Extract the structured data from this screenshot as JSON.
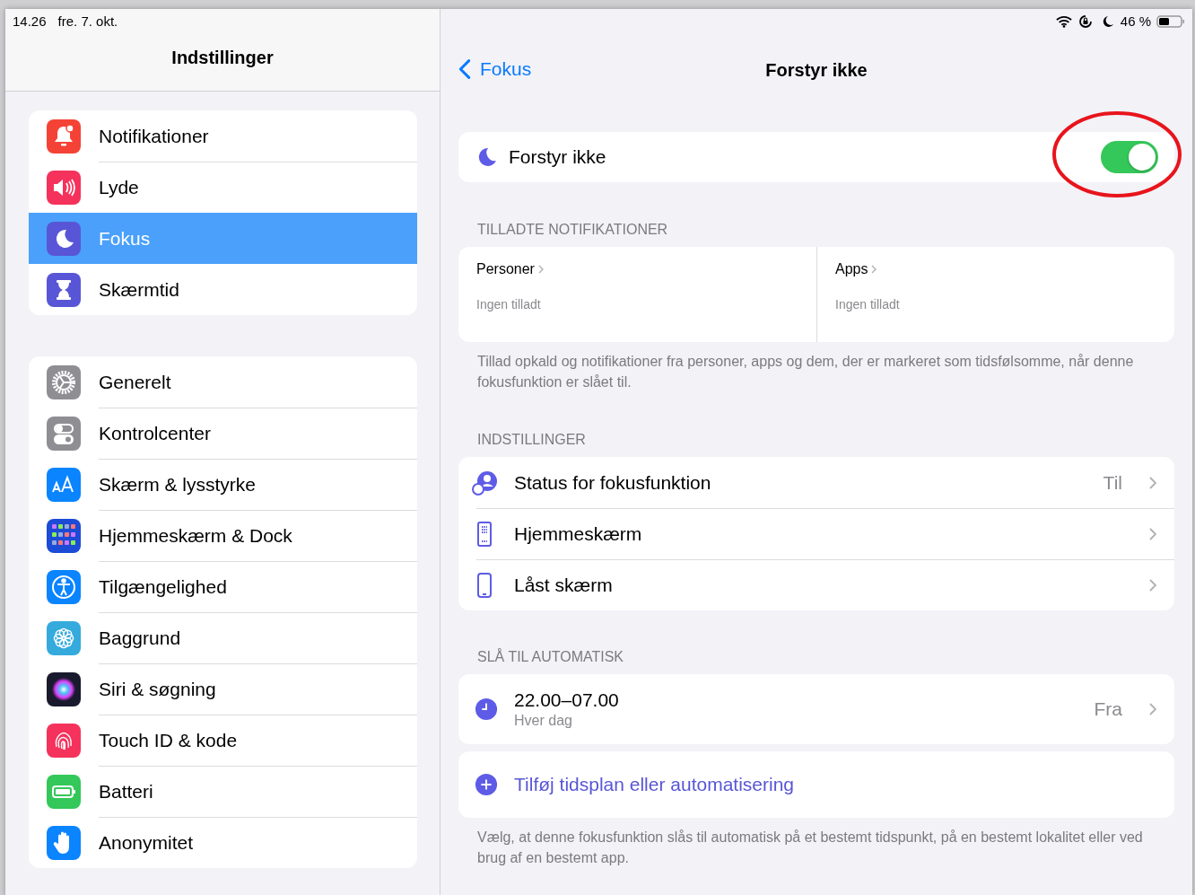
{
  "status_bar": {
    "time": "14.26",
    "date": "fre. 7. okt.",
    "battery": "46 %"
  },
  "sidebar": {
    "title": "Indstillinger",
    "groups": [
      {
        "items": [
          {
            "label": "Notifikationer",
            "kind": "bell",
            "selected": false
          },
          {
            "label": "Lyde",
            "kind": "speaker",
            "selected": false
          },
          {
            "label": "Fokus",
            "kind": "moon",
            "selected": true
          },
          {
            "label": "Skærmtid",
            "kind": "hourglass",
            "selected": false
          }
        ]
      },
      {
        "items": [
          {
            "label": "Generelt",
            "kind": "gear",
            "selected": false
          },
          {
            "label": "Kontrolcenter",
            "kind": "toggles",
            "selected": false
          },
          {
            "label": "Skærm & lysstyrke",
            "kind": "textsize",
            "selected": false
          },
          {
            "label": "Hjemmeskærm & Dock",
            "kind": "grid",
            "selected": false
          },
          {
            "label": "Tilgængelighed",
            "kind": "accessibility",
            "selected": false
          },
          {
            "label": "Baggrund",
            "kind": "flower",
            "selected": false
          },
          {
            "label": "Siri & søgning",
            "kind": "siri",
            "selected": false
          },
          {
            "label": "Touch ID & kode",
            "kind": "fingerprint",
            "selected": false
          },
          {
            "label": "Batteri",
            "kind": "battery",
            "selected": false
          },
          {
            "label": "Anonymitet",
            "kind": "hand",
            "selected": false
          }
        ]
      }
    ]
  },
  "detail": {
    "back": "Fokus",
    "title": "Forstyr ikke",
    "focus_toggle": {
      "label": "Forstyr ikke",
      "on": true
    },
    "allowed": {
      "header": "TILLADTE NOTIFIKATIONER",
      "cells": [
        {
          "title": "Personer",
          "subtitle": "Ingen tilladt"
        },
        {
          "title": "Apps",
          "subtitle": "Ingen tilladt"
        }
      ],
      "footer": "Tillad opkald og notifikationer fra personer, apps og dem, der er markeret som tidsfølsomme, når denne fokusfunktion er slået til."
    },
    "settings": {
      "header": "INDSTILLINGER",
      "rows": [
        {
          "label": "Status for fokusfunktion",
          "kind": "status",
          "value": "Til"
        },
        {
          "label": "Hjemmeskærm",
          "kind": "homescreen"
        },
        {
          "label": "Låst skærm",
          "kind": "phone"
        }
      ]
    },
    "automatic": {
      "header": "SLÅ TIL AUTOMATISK",
      "schedule": {
        "title": "22.00–07.00",
        "subtitle": "Hver dag",
        "value": "Fra"
      },
      "add_link": "Tilføj tidsplan eller automatisering",
      "footer": "Vælg, at denne fokusfunktion slås til automatisk på et bestemt tidspunkt, på en bestemt lokalitet eller ved brug af en bestemt app."
    }
  }
}
